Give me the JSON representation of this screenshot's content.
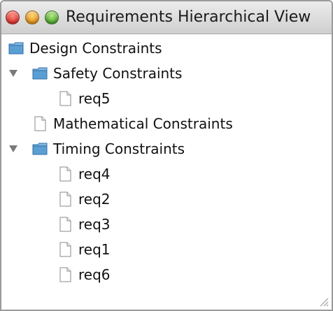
{
  "window": {
    "title": "Requirements Hierarchical View"
  },
  "tree": {
    "nodes": [
      {
        "label": "Design Constraints",
        "icon": "folder-icon",
        "expanded": null
      },
      {
        "label": "Safety Constraints",
        "icon": "folder-icon",
        "expanded": true
      },
      {
        "label": "req5",
        "icon": "document-icon",
        "expanded": null
      },
      {
        "label": "Mathematical Constraints",
        "icon": "document-icon",
        "expanded": null
      },
      {
        "label": "Timing Constraints",
        "icon": "folder-icon",
        "expanded": true
      },
      {
        "label": "req4",
        "icon": "document-icon",
        "expanded": null
      },
      {
        "label": "req2",
        "icon": "document-icon",
        "expanded": null
      },
      {
        "label": "req3",
        "icon": "document-icon",
        "expanded": null
      },
      {
        "label": "req1",
        "icon": "document-icon",
        "expanded": null
      },
      {
        "label": "req6",
        "icon": "document-icon",
        "expanded": null
      }
    ]
  },
  "colors": {
    "close_light": "#d8332b",
    "minimize_light": "#e08f14",
    "zoom_light": "#4aa52b",
    "folder": "#4a8fc7"
  }
}
